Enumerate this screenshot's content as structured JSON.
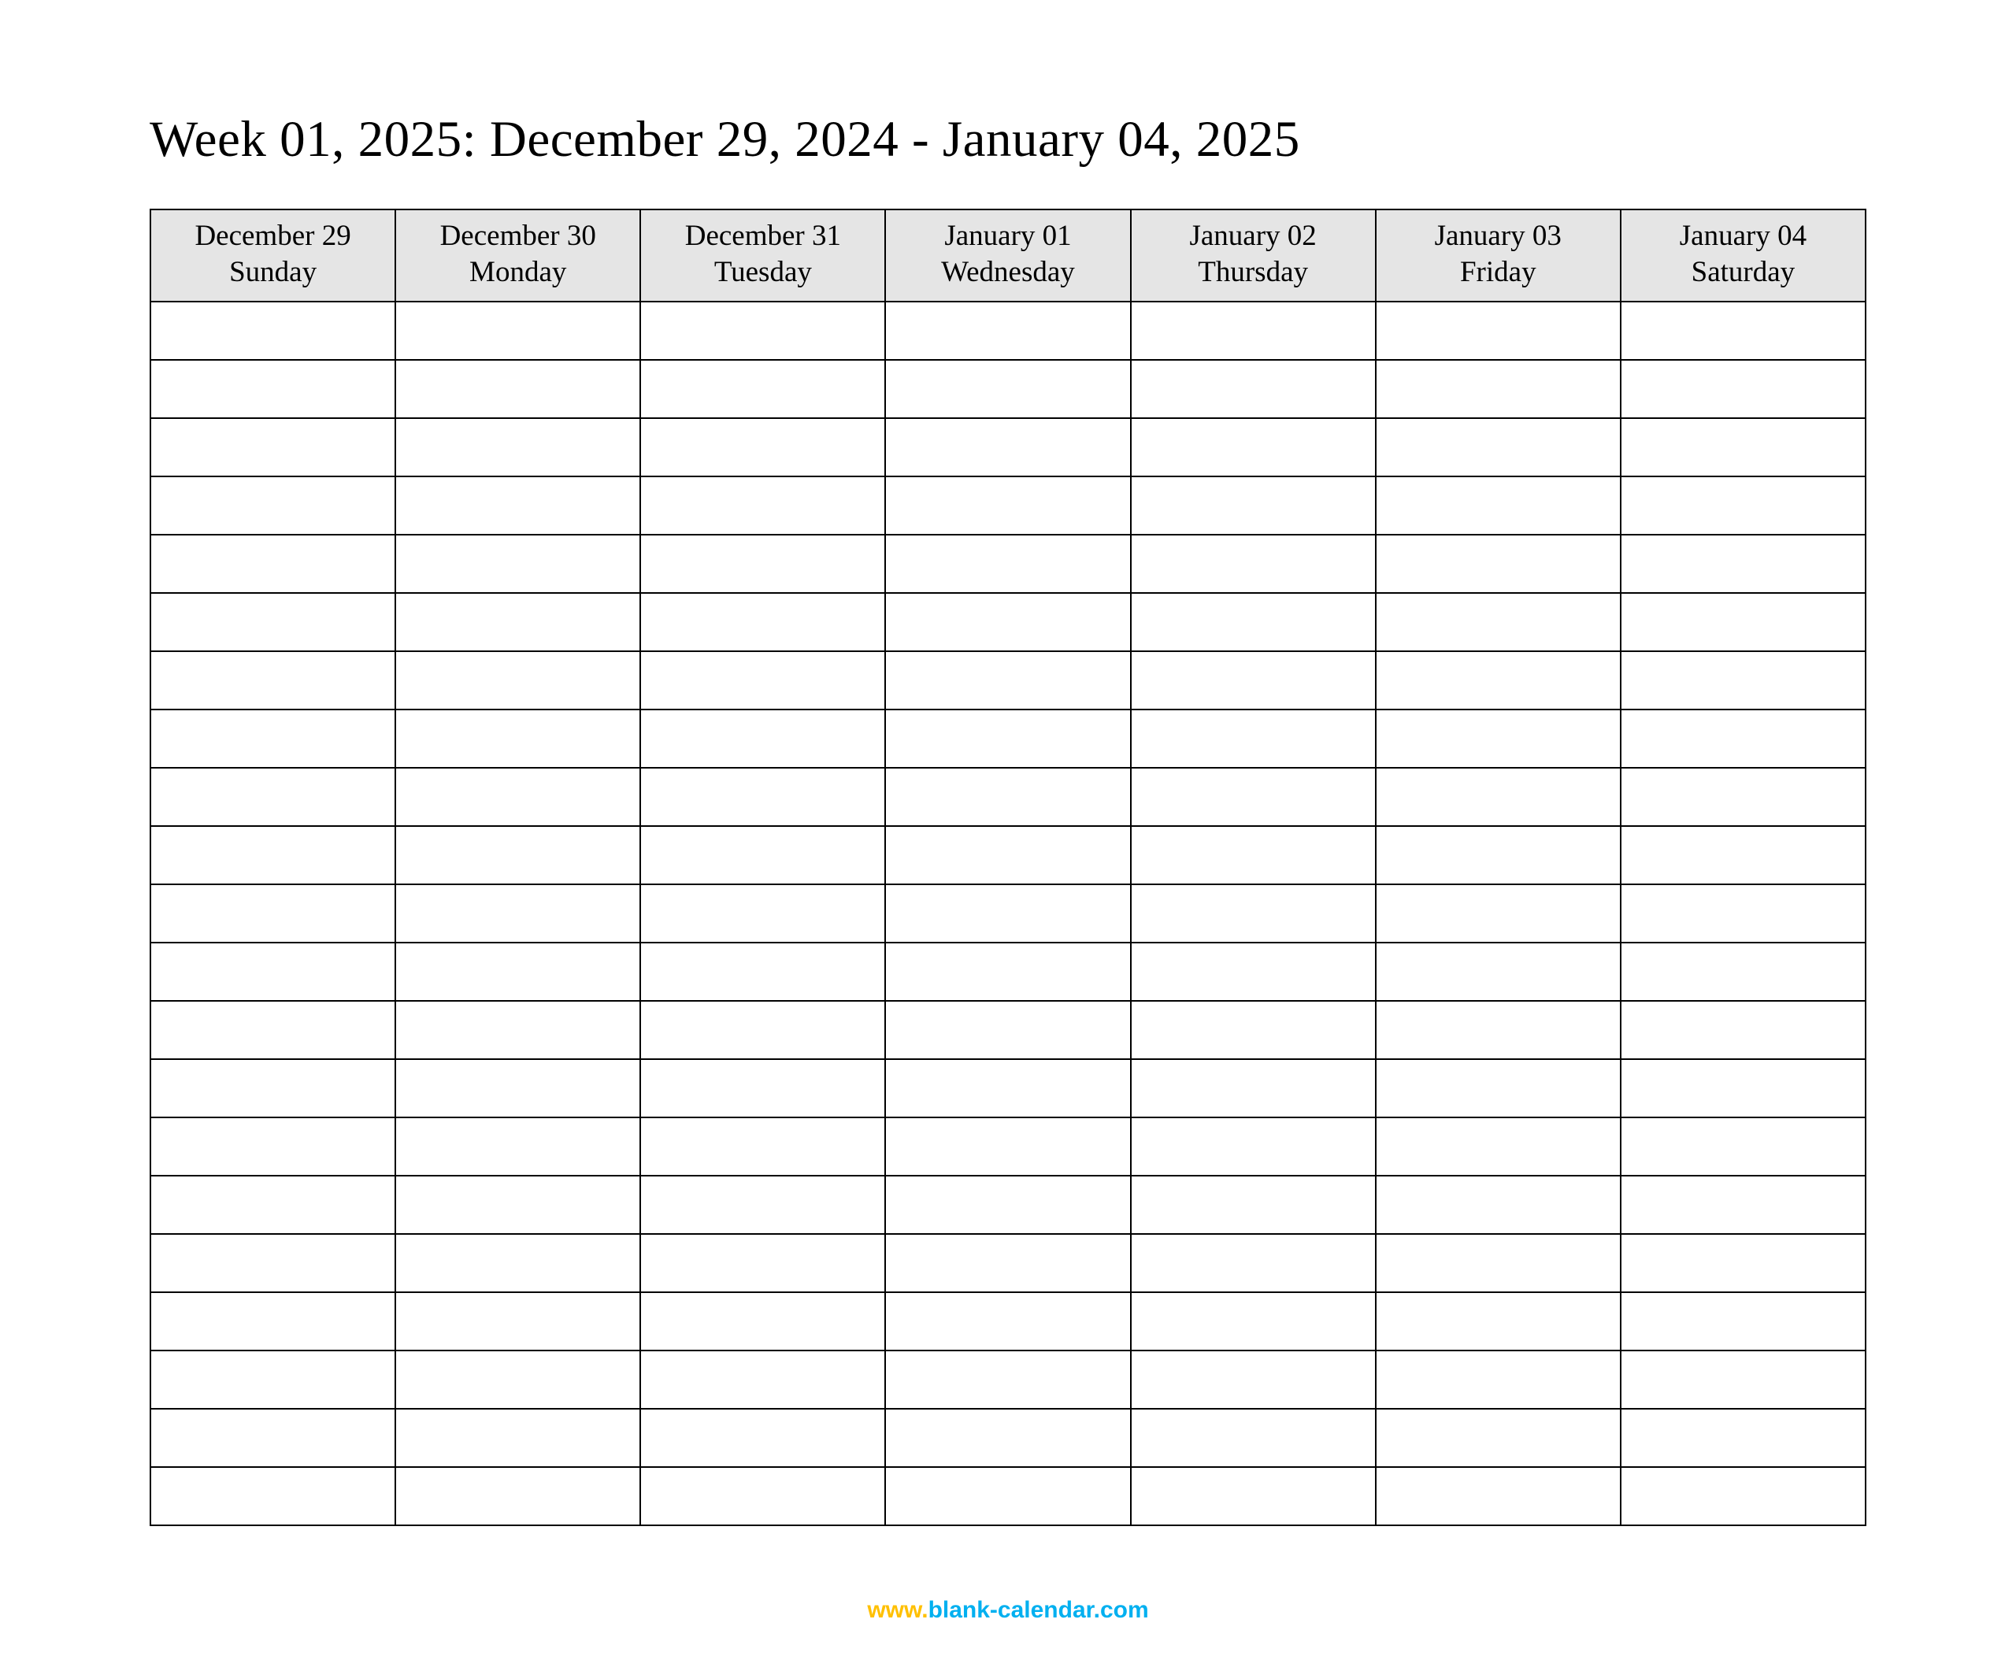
{
  "title": "Week 01, 2025: December 29, 2024 - January 04, 2025",
  "columns": [
    {
      "date": "December 29",
      "day": "Sunday"
    },
    {
      "date": "December 30",
      "day": "Monday"
    },
    {
      "date": "December 31",
      "day": "Tuesday"
    },
    {
      "date": "January 01",
      "day": "Wednesday"
    },
    {
      "date": "January 02",
      "day": "Thursday"
    },
    {
      "date": "January 03",
      "day": "Friday"
    },
    {
      "date": "January 04",
      "day": "Saturday"
    }
  ],
  "row_count": 21,
  "footer": {
    "www": "www.",
    "domain": "blank-calendar.com"
  }
}
